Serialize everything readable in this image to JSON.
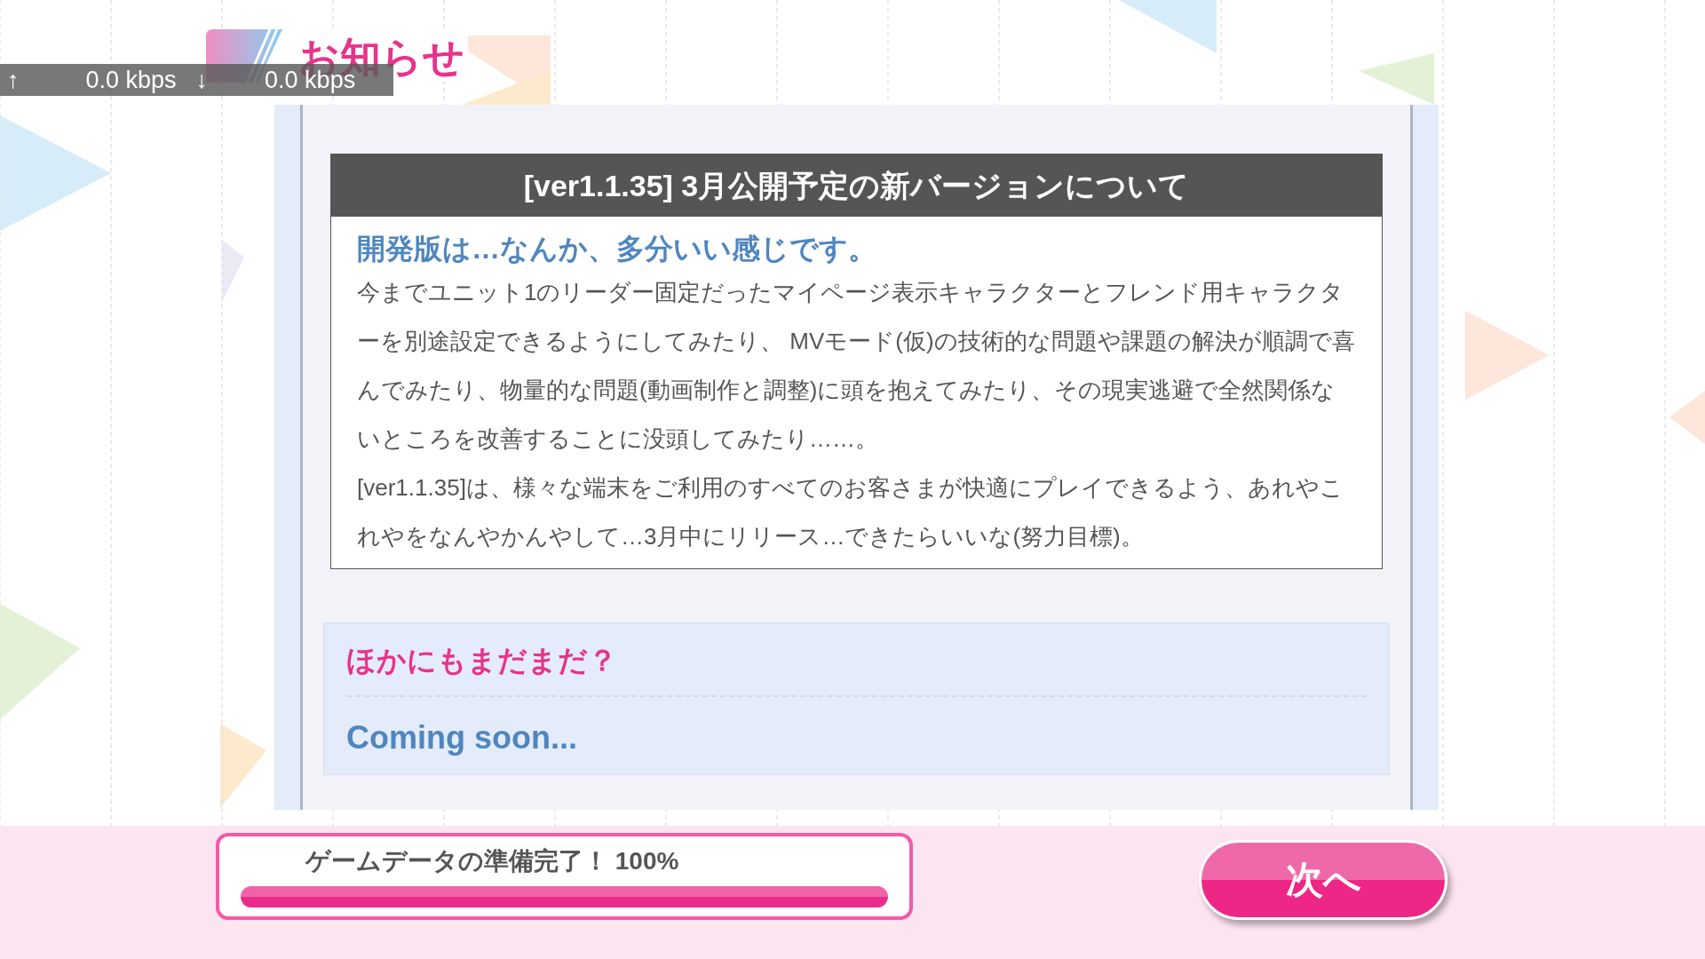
{
  "header": {
    "title": "お知らせ"
  },
  "network": {
    "up_arrow": "↑",
    "up_rate": "0.0 kbps",
    "down_arrow": "↓",
    "down_rate": "0.0 kbps"
  },
  "notice": {
    "title": "[ver1.1.35] 3月公開予定の新バージョンについて",
    "subtitle": "開発版は…なんか、多分いい感じです。",
    "paragraphs": [
      "今までユニット1のリーダー固定だったマイページ表示キャラクターとフレンド用キャラクターを別途設定できるようにしてみたり、 MVモード(仮)の技術的な問題や課題の解決が順調で喜んでみたり、物量的な問題(動画制作と調整)に頭を抱えてみたり、その現実逃避で全然関係ないところを改善することに没頭してみたり……。",
      "[ver1.1.35]は、様々な端末をご利用のすべてのお客さまが快適にプレイできるよう、あれやこれやをなんやかんやして…3月中にリリース…できたらいいな(努力目標)。"
    ]
  },
  "section": {
    "heading": "ほかにもまだまだ？",
    "text": "Coming soon..."
  },
  "progress": {
    "label": "ゲームデータの準備完了！ 100%",
    "level": 1.0
  },
  "next_button": {
    "label": "次へ"
  }
}
